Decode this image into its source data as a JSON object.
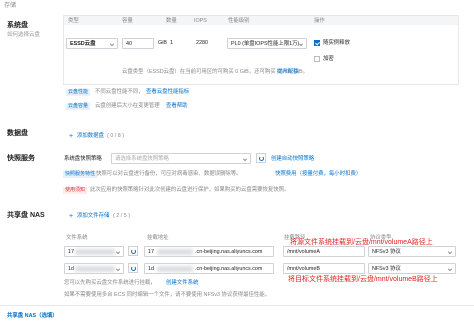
{
  "storage": {
    "heading": "存储"
  },
  "system_disk": {
    "title": "系统盘",
    "subtitle": "如何选择云盘",
    "col_type": "类型",
    "col_capacity": "容量",
    "col_qty": "数量",
    "col_iops": "IOPS",
    "col_perf": "性能级别",
    "col_ops": "操作",
    "type": "ESSD云盘",
    "capacity": "40",
    "unit": "GiB",
    "qty": "1",
    "iops": "2280",
    "perf": "PL0 (单盘IOPS性能上限1万)",
    "release_label": "随实例释放",
    "encrypt_label": "加密",
    "hint1": "云盘类型（ESSD云盘）在当前可用区的可购买 0 GiB，还可购买 65496 GiB。",
    "hint1_link": "提升配额",
    "perf_tip": "云盘性能",
    "perf_tip_text": "不同云盘性能不同，",
    "perf_tip_link": "查看云盘性能指标",
    "cap_tip": "云盘容量",
    "cap_tip_text": "云盘创建后大小在变更管理",
    "cap_tip_link": "查看帮助"
  },
  "data_disk": {
    "title": "数据盘",
    "add_label": "添加数据盘",
    "count": "( 0 / 8 )"
  },
  "snapshot": {
    "title": "快照服务",
    "policy_label": "系统盘快照策略",
    "policy_placeholder": "请选择系统盘快照策略",
    "create_link": "创建自动快照策略",
    "badge": "快照服务特性",
    "badge_text": "快照可以对云盘进行备份，可应对病毒感染、数据误删除等。",
    "badge_link": "快照费用（按量付费，每小时扣费）",
    "use_badge": "使用须知",
    "use_text": "此次应用的快照策略针对此次创建的云盘进行保护，如果购买的云盘需要恢复快照。"
  },
  "nas": {
    "title": "共享盘 NAS",
    "add_label": "添加文件存储",
    "count": "( 2 / 5 )",
    "col_fs": "文件系统",
    "col_mount": "挂载地址",
    "col_path": "挂载路径",
    "col_protocol": "协议类型",
    "rows": [
      {
        "fs": "17",
        "mount_prefix": "17",
        "mount_suffix": ".cn-beijing.nas.aliyuncs.com",
        "path": "/mnt/volumeA",
        "protocol": "NFSv3 协议"
      },
      {
        "fs": "1d",
        "mount_prefix": "1d",
        "mount_suffix": ".cn-beijing.nas.aliyuncs.com",
        "path": "/mnt/volumeB",
        "protocol": "NFSv3 协议"
      }
    ],
    "annot1": "将源文件系统挂载到/云盘/mnt/volumeA路径上",
    "annot2": "将目标文件系统挂载到/云盘/mnt/volumeB路径上",
    "note1": "您可以先购买云盘文件系统进行挂载，",
    "note1_link": "创建文件系统",
    "note2": "如果不需要使用多台 ECS 同时编辑一个文件，请不要使用 NFSv3 协议获得最佳性能。",
    "next_title": "共享盘 NAS（选填）"
  }
}
